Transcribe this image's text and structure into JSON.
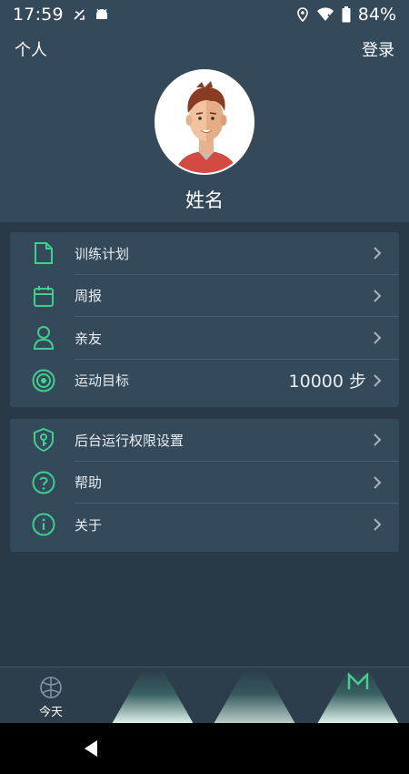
{
  "status_bar": {
    "time": "17:59",
    "battery": "84%"
  },
  "top_nav": {
    "left_label": "个人",
    "right_label": "登录"
  },
  "profile": {
    "name": "姓名"
  },
  "menu_group_1": [
    {
      "label": "训练计划",
      "icon": "document-icon"
    },
    {
      "label": "周报",
      "icon": "calendar-icon"
    },
    {
      "label": "亲友",
      "icon": "person-icon"
    },
    {
      "label": "运动目标",
      "icon": "target-icon",
      "value": "10000 步"
    }
  ],
  "menu_group_2": [
    {
      "label": "后台运行权限设置",
      "icon": "shield-key-icon"
    },
    {
      "label": "帮助",
      "icon": "help-icon"
    },
    {
      "label": "关于",
      "icon": "info-icon"
    }
  ],
  "bottom_nav": {
    "tabs": [
      {
        "label": "今天",
        "icon": "basketball-icon"
      }
    ]
  },
  "colors": {
    "accent": "#3fcf8e",
    "header_bg": "#34495a",
    "page_bg": "#2a3947",
    "avatar_shirt": "#d24a42"
  }
}
